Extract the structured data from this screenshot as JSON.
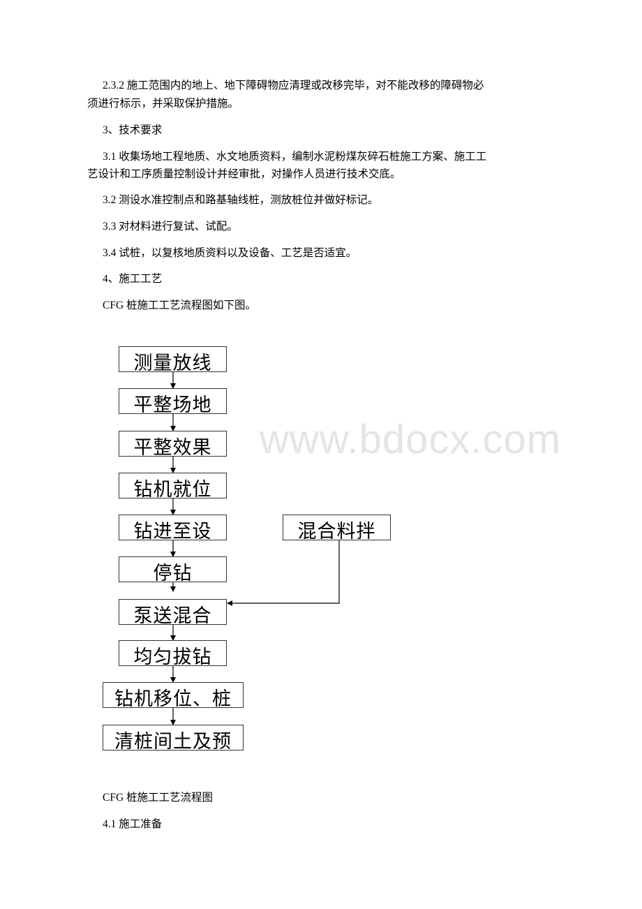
{
  "document": {
    "paragraphs": [
      {
        "id": "p232",
        "text_line1": "2.3.2 施工范围内的地上、地下障碍物应清理或改移完毕，对不能改移的障碍物必",
        "text_line2": "须进行标示，并采取保护措施。"
      },
      {
        "id": "h3",
        "text": "3、技术要求"
      },
      {
        "id": "p31",
        "text_line1": "3.1 收集场地工程地质、水文地质资料，编制水泥粉煤灰碎石桩施工方案、施工工",
        "text_line2": "艺设计和工序质量控制设计并经审批，对操作人员进行技术交底。"
      },
      {
        "id": "p32",
        "text": "3.2 测设水准控制点和路基轴线桩，测放桩位并做好标记。"
      },
      {
        "id": "p33",
        "text": "3.3 对材料进行复试、试配。"
      },
      {
        "id": "p34",
        "text": "3.4 试桩，以复核地质资料以及设备、工艺是否适宜。"
      },
      {
        "id": "h4",
        "text": "4、施工工艺"
      },
      {
        "id": "intro",
        "text": "CFG 桩施工工艺流程图如下图。"
      }
    ],
    "caption": "CFG 桩施工工艺流程图",
    "next_heading": "4.1 施工准备",
    "watermark": "www.bdocx.com"
  },
  "flowchart": {
    "main_steps": [
      "测量放线",
      "平整场地",
      "平整效果",
      "钻机就位",
      "钻进至设",
      "停钻",
      "泵送混合",
      "均匀拔钻",
      "钻机移位、桩",
      "清桩间土及预"
    ],
    "side_step": "混合料拌",
    "side_step_feeds_into": "泵送混合"
  }
}
